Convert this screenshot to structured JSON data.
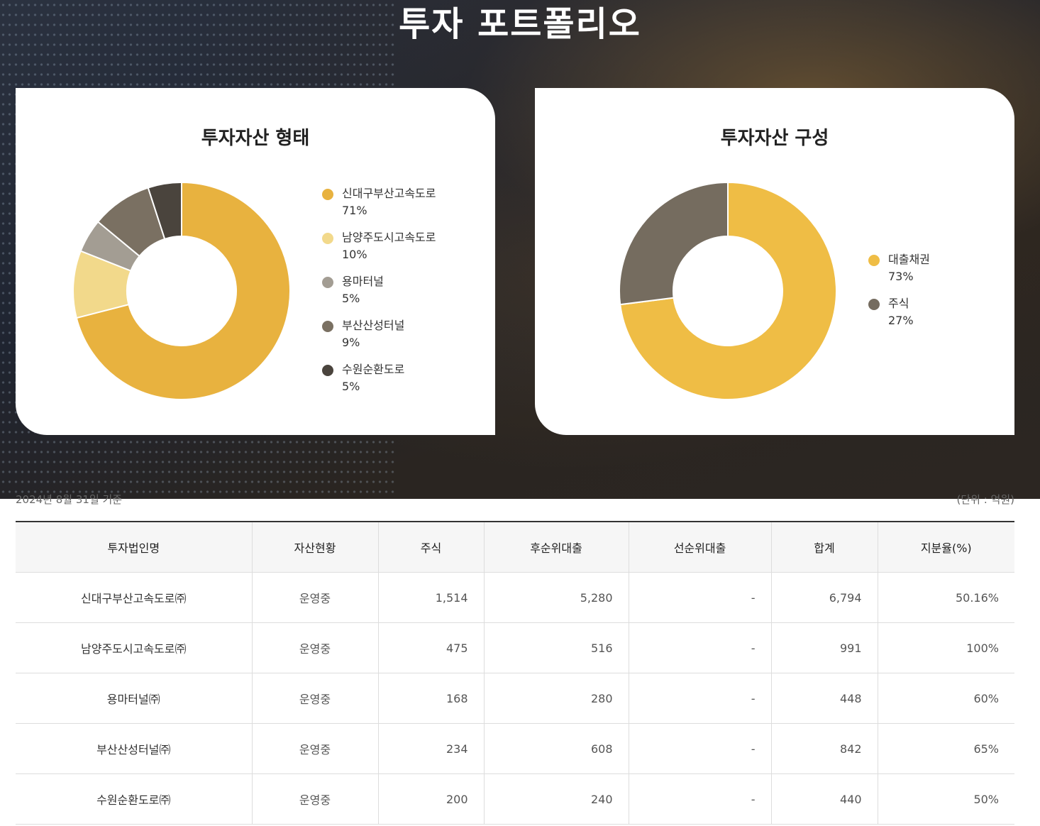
{
  "page_title": "투자 포트폴리오",
  "chart_data": [
    {
      "type": "pie",
      "title": "투자자산 형태",
      "categories": [
        "신대구부산고속도로",
        "남양주도시고속도로",
        "용마터널",
        "부산산성터널",
        "수원순환도로"
      ],
      "values": [
        71,
        10,
        5,
        9,
        5
      ],
      "value_labels": [
        "71%",
        "10%",
        "5%",
        "9%",
        "5%"
      ],
      "colors": [
        "#e8b23f",
        "#f2d98b",
        "#a39d93",
        "#7a7062",
        "#4a443d"
      ],
      "donut": true,
      "legend_position": "right"
    },
    {
      "type": "pie",
      "title": "투자자산 구성",
      "categories": [
        "대출채권",
        "주식"
      ],
      "values": [
        73,
        27
      ],
      "value_labels": [
        "73%",
        "27%"
      ],
      "colors": [
        "#efbd45",
        "#756c5f"
      ],
      "donut": true,
      "legend_position": "right"
    }
  ],
  "table": {
    "date_note": "2024년 8월 31일 기준",
    "unit_note": "(단위 : 억원)",
    "headers": [
      "투자법인명",
      "자산현황",
      "주식",
      "후순위대출",
      "선순위대출",
      "합계",
      "지분율(%)"
    ],
    "rows": [
      [
        "신대구부산고속도로㈜",
        "운영중",
        "1,514",
        "5,280",
        "-",
        "6,794",
        "50.16%"
      ],
      [
        "남양주도시고속도로㈜",
        "운영중",
        "475",
        "516",
        "-",
        "991",
        "100%"
      ],
      [
        "용마터널㈜",
        "운영중",
        "168",
        "280",
        "-",
        "448",
        "60%"
      ],
      [
        "부산산성터널㈜",
        "운영중",
        "234",
        "608",
        "-",
        "842",
        "65%"
      ],
      [
        "수원순환도로㈜",
        "운영중",
        "200",
        "240",
        "-",
        "440",
        "50%"
      ]
    ]
  }
}
